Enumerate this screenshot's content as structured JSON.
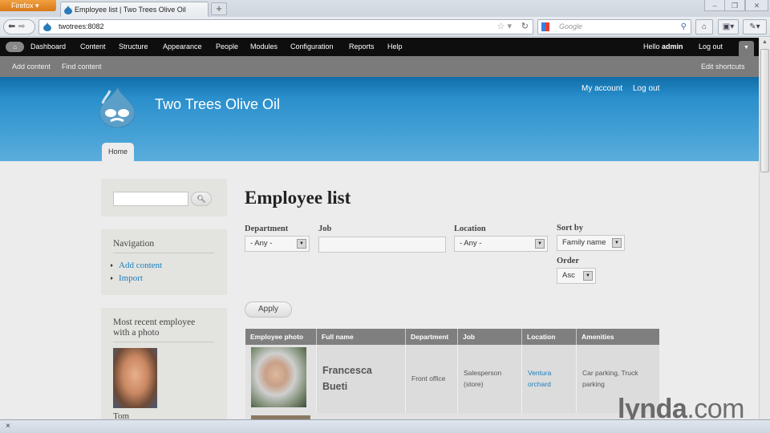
{
  "browser": {
    "app_button": "Firefox",
    "tab_title": "Employee list | Two Trees Olive Oil",
    "new_tab": "+",
    "url": "twotrees:8082",
    "search_placeholder": "Google",
    "window_controls": [
      "–",
      "❐",
      "✕"
    ]
  },
  "admin_toolbar": {
    "menu": [
      "Dashboard",
      "Content",
      "Structure",
      "Appearance",
      "People",
      "Modules",
      "Configuration",
      "Reports",
      "Help"
    ],
    "greeting_prefix": "Hello ",
    "greeting_user": "admin",
    "logout": "Log out"
  },
  "shortcuts": {
    "items": [
      "Add content",
      "Find content"
    ],
    "edit": "Edit shortcuts"
  },
  "header": {
    "site_name": "Two Trees Olive Oil",
    "links": [
      "My account",
      "Log out"
    ],
    "tabs": [
      "Home"
    ]
  },
  "sidebar": {
    "search": {
      "value": "",
      "button_icon": "search-icon"
    },
    "navigation": {
      "title": "Navigation",
      "items": [
        "Add content",
        "Import"
      ]
    },
    "recent": {
      "title_line1": "Most recent employee",
      "title_line2": "with a photo",
      "name": "Tom"
    }
  },
  "main": {
    "title": "Employee list",
    "filters": {
      "department": {
        "label": "Department",
        "value": "- Any -"
      },
      "job": {
        "label": "Job",
        "value": ""
      },
      "location": {
        "label": "Location",
        "value": "- Any -"
      },
      "sort_by": {
        "label": "Sort by",
        "value": "Family name"
      },
      "order": {
        "label": "Order",
        "value": "Asc"
      }
    },
    "apply": "Apply",
    "table": {
      "columns": [
        "Employee photo",
        "Full name",
        "Department",
        "Job",
        "Location",
        "Amenities"
      ],
      "rows": [
        {
          "full_name_first": "Francesca",
          "full_name_last": "Bueti",
          "department": "Front office",
          "job_line1": "Salesperson",
          "job_line2": "(store)",
          "location_line1": "Ventura",
          "location_line2": "orchard",
          "amenities_line1": "Car parking, Truck",
          "amenities_line2": "parking"
        }
      ]
    }
  },
  "colors": {
    "link": "#1a7fc0",
    "header_top": "#0f6ea8",
    "header_bottom": "#5aaedc",
    "table_header": "#7f7f7f"
  },
  "watermark": {
    "bold": "lynda",
    "rest": ".com"
  },
  "statusbar": {
    "close": "×"
  }
}
